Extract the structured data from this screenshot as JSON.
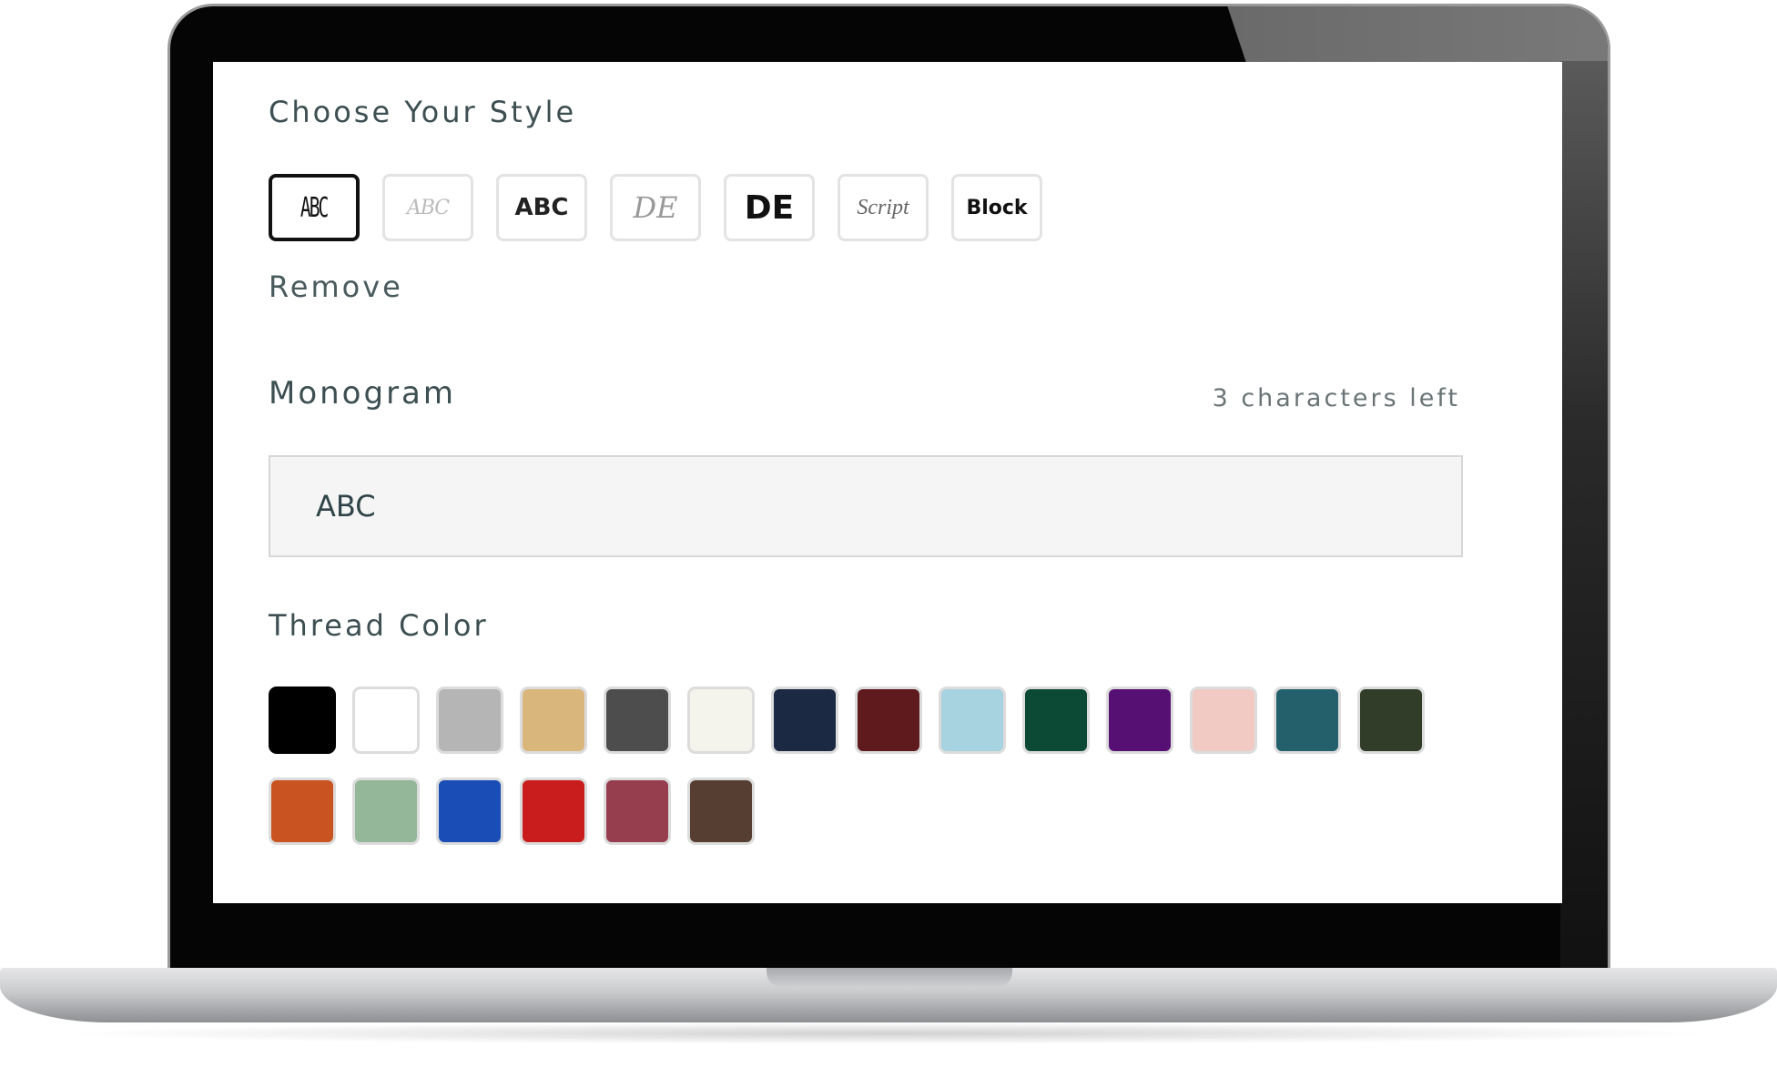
{
  "style_section": {
    "title": "Choose Your Style",
    "options": [
      {
        "label": "ABC",
        "style": "circle",
        "selected": true
      },
      {
        "label": "ABC",
        "style": "script",
        "selected": false
      },
      {
        "label": "ABC",
        "style": "sans-serif",
        "selected": false
      },
      {
        "label": "DE",
        "style": "fancy",
        "selected": false
      },
      {
        "label": "DE",
        "style": "bold",
        "selected": false
      },
      {
        "label": "Script",
        "style": "script-word",
        "selected": false
      },
      {
        "label": "Block",
        "style": "block",
        "selected": false
      }
    ],
    "remove_label": "Remove"
  },
  "monogram": {
    "title": "Monogram",
    "chars_left": "3 characters left",
    "value": "ABC"
  },
  "thread_color": {
    "title": "Thread Color",
    "selected_index": 0,
    "colors": [
      "#000000",
      "#ffffff",
      "#b5b5b5",
      "#d9b67c",
      "#4d4d4d",
      "#f4f4ec",
      "#1c2942",
      "#5e1a1d",
      "#a7d2df",
      "#0c4a36",
      "#560f73",
      "#f1cbc3",
      "#245f6c",
      "#313c29",
      "#c95421",
      "#94b79a",
      "#1a4db5",
      "#c91c1c",
      "#963e4e",
      "#563f32"
    ]
  }
}
